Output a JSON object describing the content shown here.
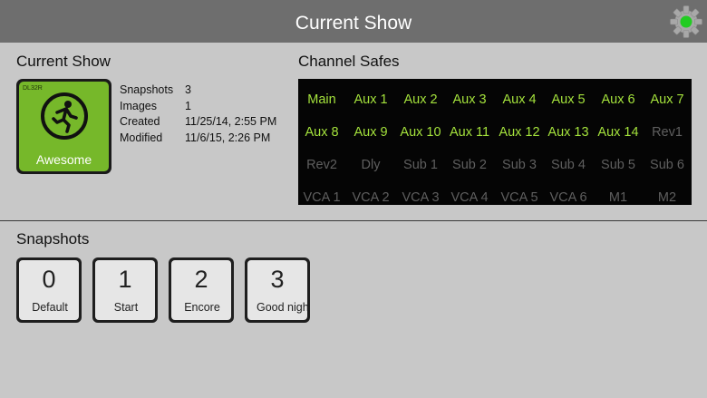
{
  "header": {
    "title": "Current Show",
    "settings_icon": "gear-icon",
    "status_color": "#22cc22"
  },
  "current_show": {
    "section_title": "Current Show",
    "model": "DL32R",
    "show_name": "Awesome",
    "logo_icon": "running-man-icon",
    "thumb_color": "#76b82a",
    "info": [
      {
        "key": "Snapshots",
        "value": "3"
      },
      {
        "key": "Images",
        "value": "1"
      },
      {
        "key": "Created",
        "value": "11/25/14, 2:55 PM"
      },
      {
        "key": "Modified",
        "value": "11/6/15, 2:26 PM"
      }
    ]
  },
  "channel_safes": {
    "section_title": "Channel Safes",
    "active_color": "#a4e23c",
    "inactive_color": "#5f5f5f",
    "rows": [
      [
        {
          "label": "Main",
          "on": true
        },
        {
          "label": "Aux 1",
          "on": true
        },
        {
          "label": "Aux 2",
          "on": true
        },
        {
          "label": "Aux 3",
          "on": true
        },
        {
          "label": "Aux 4",
          "on": true
        },
        {
          "label": "Aux 5",
          "on": true
        },
        {
          "label": "Aux 6",
          "on": true
        },
        {
          "label": "Aux 7",
          "on": true
        }
      ],
      [
        {
          "label": "Aux 8",
          "on": true
        },
        {
          "label": "Aux 9",
          "on": true
        },
        {
          "label": "Aux 10",
          "on": true
        },
        {
          "label": "Aux 11",
          "on": true
        },
        {
          "label": "Aux 12",
          "on": true
        },
        {
          "label": "Aux 13",
          "on": true
        },
        {
          "label": "Aux 14",
          "on": true
        },
        {
          "label": "Rev1",
          "on": false
        }
      ],
      [
        {
          "label": "Rev2",
          "on": false
        },
        {
          "label": "Dly",
          "on": false
        },
        {
          "label": "Sub 1",
          "on": false
        },
        {
          "label": "Sub 2",
          "on": false
        },
        {
          "label": "Sub 3",
          "on": false
        },
        {
          "label": "Sub 4",
          "on": false
        },
        {
          "label": "Sub 5",
          "on": false
        },
        {
          "label": "Sub 6",
          "on": false
        }
      ],
      [
        {
          "label": "VCA 1",
          "on": false
        },
        {
          "label": "VCA 2",
          "on": false
        },
        {
          "label": "VCA 3",
          "on": false
        },
        {
          "label": "VCA 4",
          "on": false
        },
        {
          "label": "VCA 5",
          "on": false
        },
        {
          "label": "VCA 6",
          "on": false
        },
        {
          "label": "M1",
          "on": false
        },
        {
          "label": "M2",
          "on": false
        }
      ]
    ]
  },
  "snapshots": {
    "section_title": "Snapshots",
    "items": [
      {
        "number": "0",
        "label": "Default"
      },
      {
        "number": "1",
        "label": "Start"
      },
      {
        "number": "2",
        "label": "Encore"
      },
      {
        "number": "3",
        "label": "Good night"
      }
    ]
  }
}
